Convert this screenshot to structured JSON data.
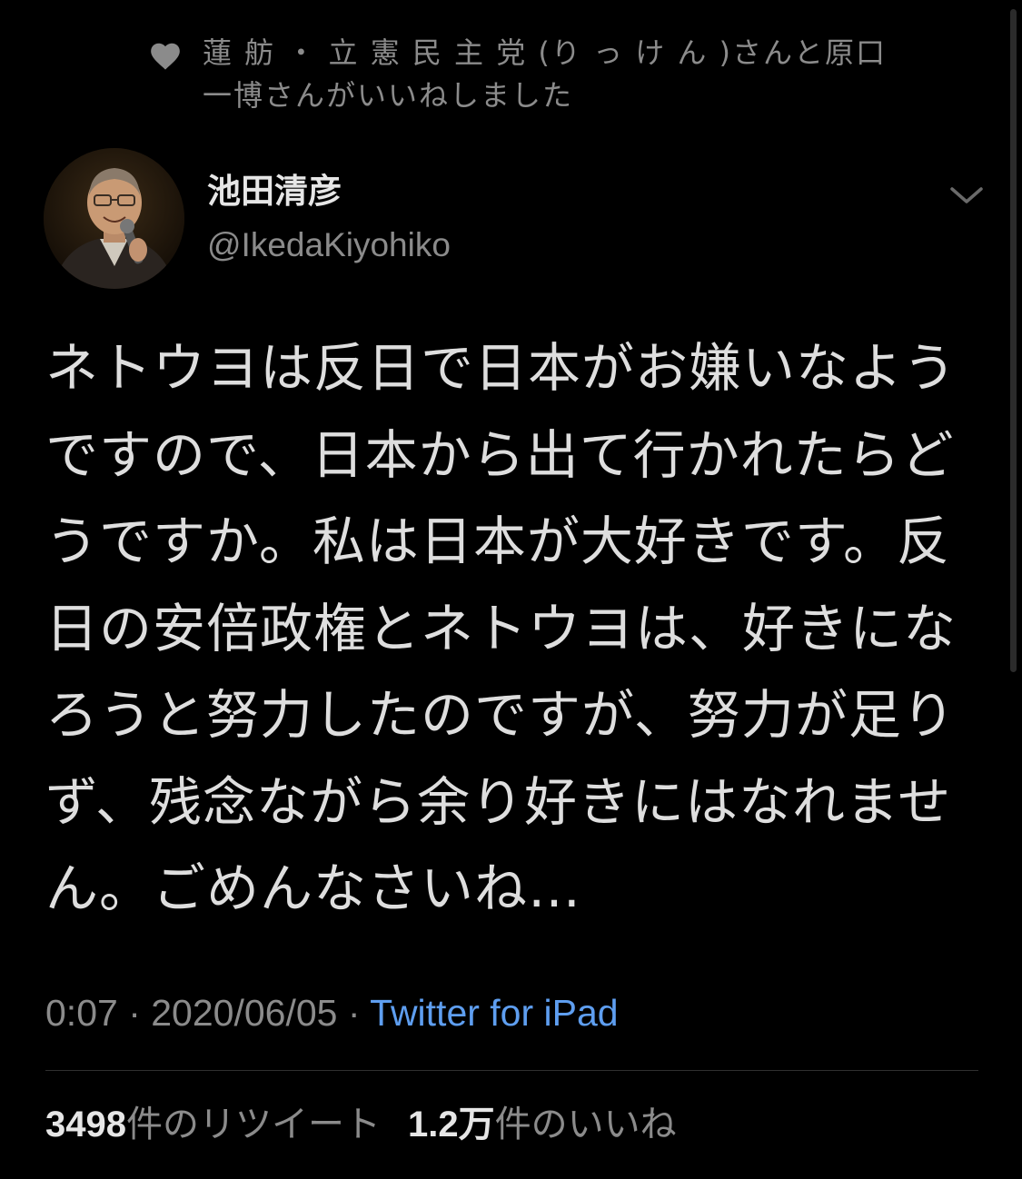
{
  "social_context": {
    "icon": "heart-icon",
    "text": "蓮 舫 ・ 立 憲 民 主 党 (り っ け ん )さんと原口　一博さんがいいねしました"
  },
  "author": {
    "display_name": "池田清彦",
    "handle": "@IkedaKiyohiko",
    "avatar": "avatar"
  },
  "tweet": {
    "text": "ネトウヨは反日で日本がお嫌いなようですので、日本から出て行かれたらどうですか。私は日本が大好きです。反日の安倍政権とネトウヨは、好きになろうと努力したのですが、努力が足りず、残念ながら余り好きにはなれません。ごめんなさいね…"
  },
  "meta": {
    "time": "0:07",
    "sep1": " · ",
    "date": "2020/06/05",
    "sep2": " · ",
    "source": "Twitter for iPad"
  },
  "stats": {
    "retweet_count": "3498",
    "retweet_label": "件のリツイート",
    "like_count": "1.2万",
    "like_label": "件のいいね"
  },
  "colors": {
    "background": "#000000",
    "link": "#5e9ef0",
    "secondary_text": "#8b8b8b"
  }
}
